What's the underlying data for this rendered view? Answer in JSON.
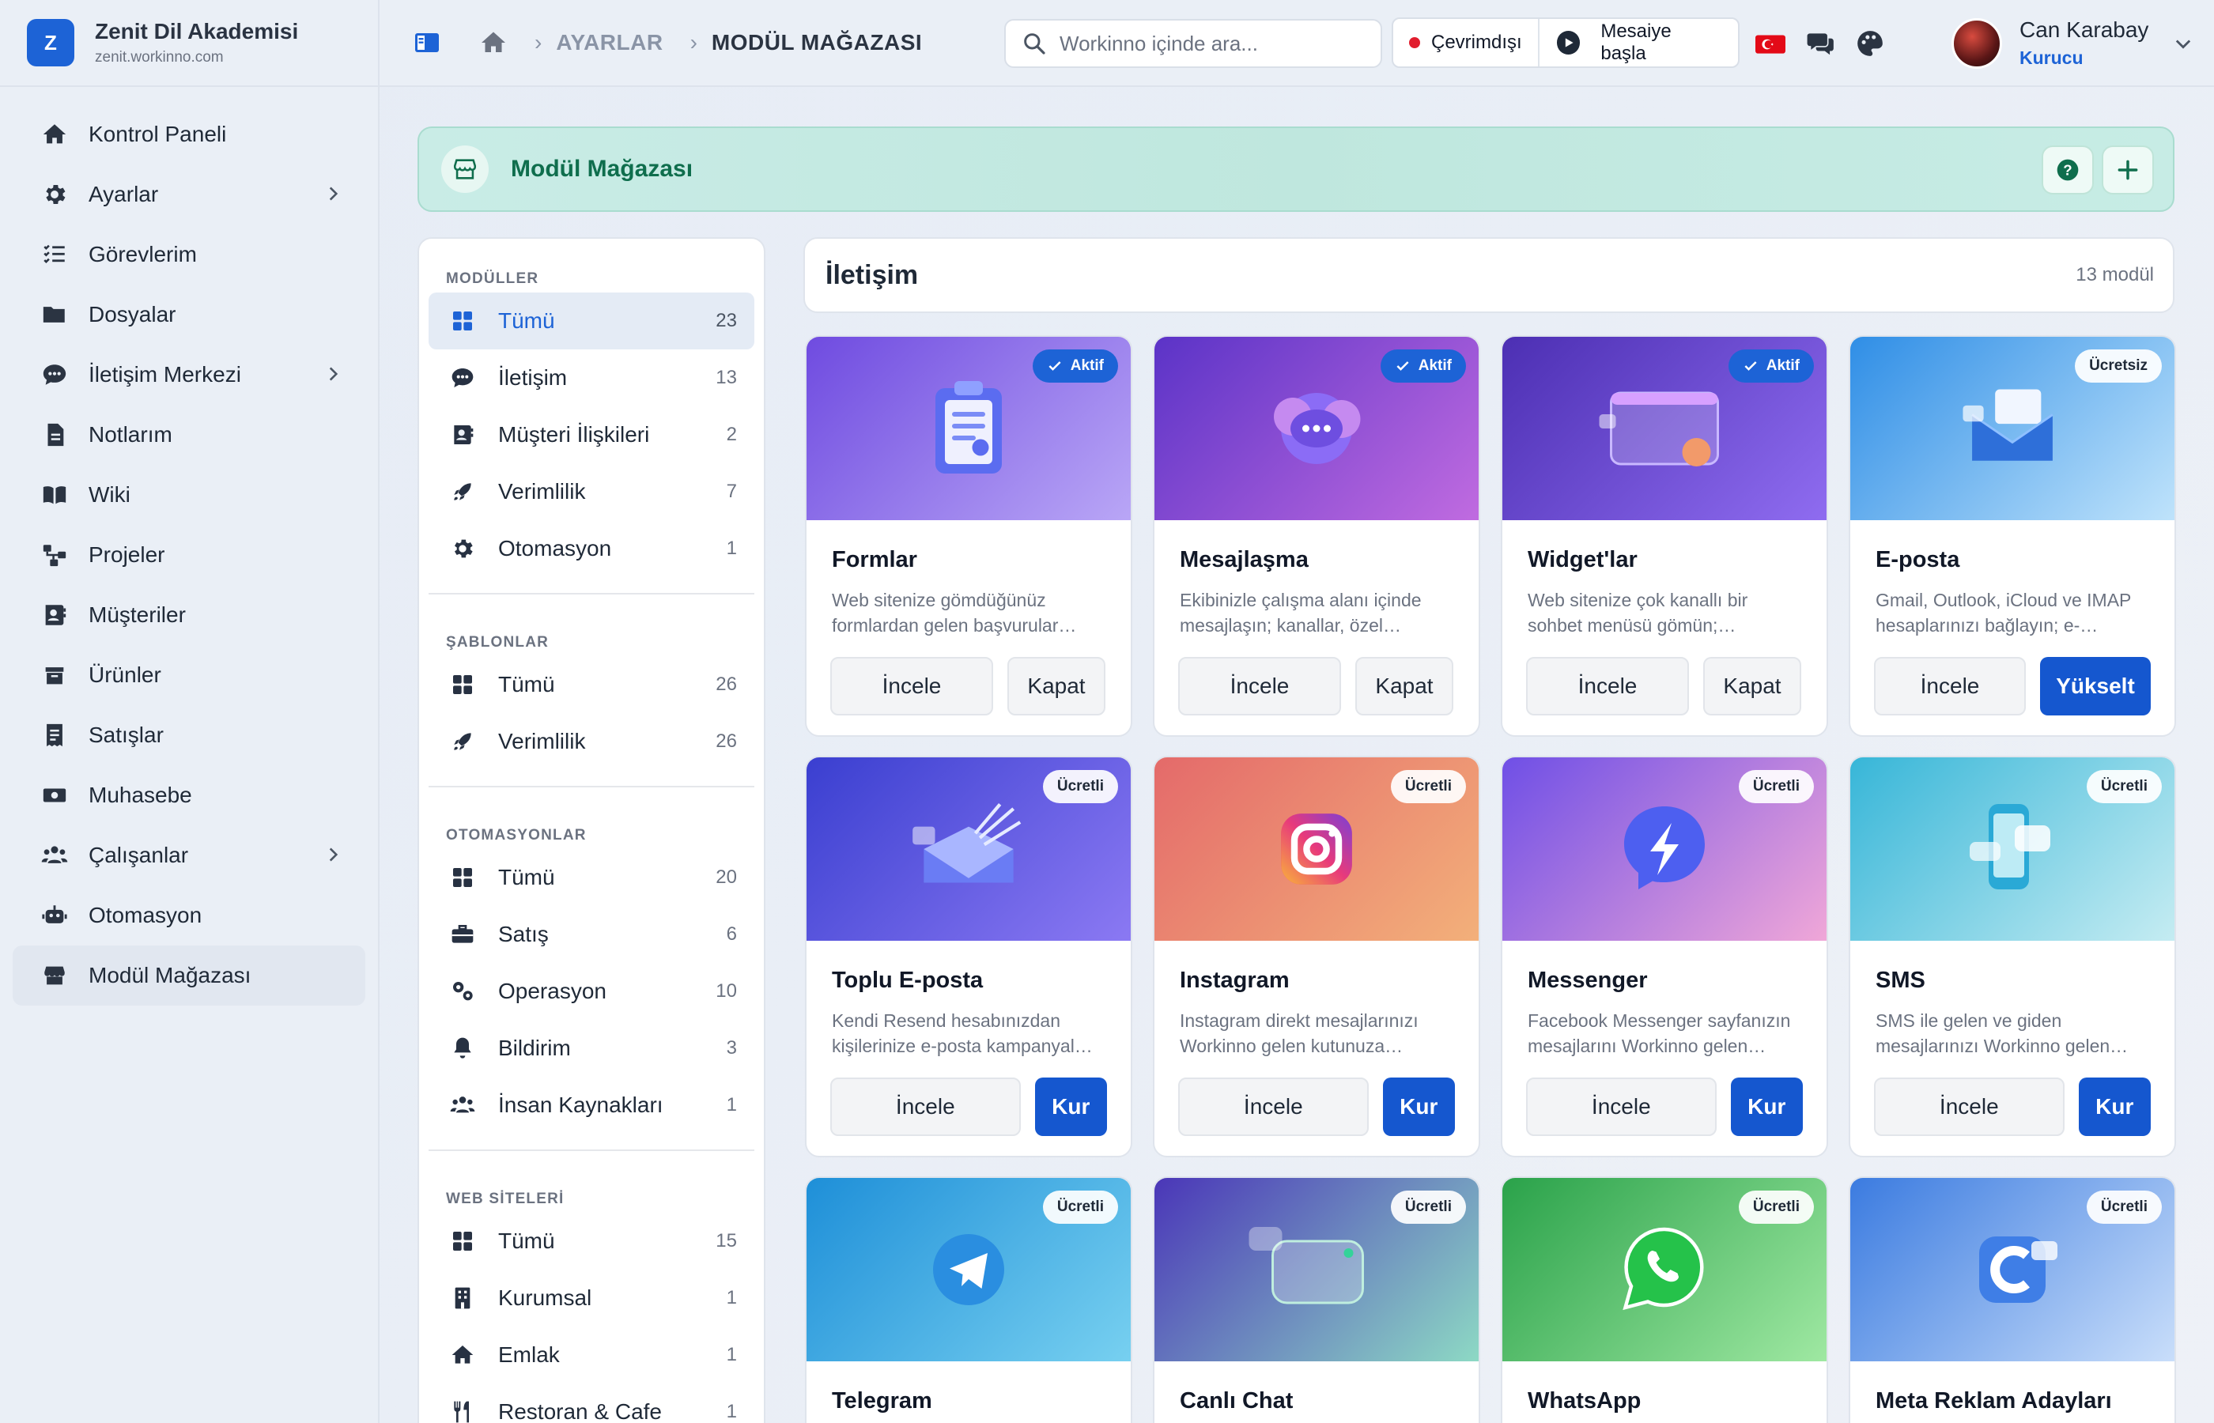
{
  "brand": {
    "logo_letter": "Z",
    "name": "Zenit Dil Akademisi",
    "url": "zenit.workinno.com"
  },
  "sidebar": {
    "items": [
      {
        "label": "Kontrol Paneli",
        "icon": "home-icon"
      },
      {
        "label": "Ayarlar",
        "icon": "gear-icon",
        "chevron": true
      },
      {
        "label": "Görevlerim",
        "icon": "tasks-icon"
      },
      {
        "label": "Dosyalar",
        "icon": "folder-icon"
      },
      {
        "label": "İletişim Merkezi",
        "icon": "chat-icon",
        "chevron": true
      },
      {
        "label": "Notlarım",
        "icon": "note-icon"
      },
      {
        "label": "Wiki",
        "icon": "book-icon"
      },
      {
        "label": "Projeler",
        "icon": "project-icon"
      },
      {
        "label": "Müşteriler",
        "icon": "contacts-icon"
      },
      {
        "label": "Ürünler",
        "icon": "box-icon"
      },
      {
        "label": "Satışlar",
        "icon": "receipt-icon"
      },
      {
        "label": "Muhasebe",
        "icon": "money-icon"
      },
      {
        "label": "Çalışanlar",
        "icon": "users-icon",
        "chevron": true
      },
      {
        "label": "Otomasyon",
        "icon": "robot-icon"
      },
      {
        "label": "Modül Mağazası",
        "icon": "store-icon",
        "active": true
      }
    ]
  },
  "topbar": {
    "breadcrumb": [
      "AYARLAR",
      "MODÜL MAĞAZASI"
    ],
    "search_placeholder": "Workinno içinde ara...",
    "status_offline": "Çevrimdışı",
    "status_start": "Mesaiye başla",
    "user_name": "Can Karabay",
    "user_role": "Kurucu"
  },
  "banner": {
    "title": "Modül Mağazası"
  },
  "filters": {
    "sections": [
      {
        "title": "MODÜLLER",
        "items": [
          {
            "label": "Tümü",
            "count": "23",
            "icon": "grid-icon",
            "active": true
          },
          {
            "label": "İletişim",
            "count": "13",
            "icon": "chat-icon"
          },
          {
            "label": "Müşteri İlişkileri",
            "count": "2",
            "icon": "contacts-icon"
          },
          {
            "label": "Verimlilik",
            "count": "7",
            "icon": "rocket-icon"
          },
          {
            "label": "Otomasyon",
            "count": "1",
            "icon": "gear-icon"
          }
        ]
      },
      {
        "title": "ŞABLONLAR",
        "items": [
          {
            "label": "Tümü",
            "count": "26",
            "icon": "grid-icon"
          },
          {
            "label": "Verimlilik",
            "count": "26",
            "icon": "rocket-icon"
          }
        ]
      },
      {
        "title": "OTOMASYONLAR",
        "items": [
          {
            "label": "Tümü",
            "count": "20",
            "icon": "grid-icon"
          },
          {
            "label": "Satış",
            "count": "6",
            "icon": "briefcase-icon"
          },
          {
            "label": "Operasyon",
            "count": "10",
            "icon": "gears-icon"
          },
          {
            "label": "Bildirim",
            "count": "3",
            "icon": "bell-icon"
          },
          {
            "label": "İnsan Kaynakları",
            "count": "1",
            "icon": "users-icon"
          }
        ]
      },
      {
        "title": "WEB SİTELERİ",
        "items": [
          {
            "label": "Tümü",
            "count": "15",
            "icon": "grid-icon"
          },
          {
            "label": "Kurumsal",
            "count": "1",
            "icon": "building-icon"
          },
          {
            "label": "Emlak",
            "count": "1",
            "icon": "home-icon"
          },
          {
            "label": "Restoran & Cafe",
            "count": "1",
            "icon": "utensils-icon"
          }
        ]
      }
    ]
  },
  "content": {
    "title": "İletişim",
    "count": "13 modül",
    "cards": [
      {
        "title": "Formlar",
        "desc": "Web sitenize gömdüğünüz formlardan gelen başvurular…",
        "badge": "Aktif",
        "badge_type": "active",
        "secondary": "İncele",
        "primary": "Kapat",
        "primary_style": "ghost",
        "art": "clipboard-icon",
        "bg": "#6f4be0",
        "bg2": "#b9a6f6"
      },
      {
        "title": "Mesajlaşma",
        "desc": "Ekibinizle çalışma alanı içinde mesajlaşın; kanallar, özel…",
        "badge": "Aktif",
        "badge_type": "active",
        "secondary": "İncele",
        "primary": "Kapat",
        "primary_style": "ghost",
        "art": "chat-bubbles-icon",
        "bg": "#5b33c7",
        "bg2": "#c06be0"
      },
      {
        "title": "Widget'lar",
        "desc": "Web sitenize çok kanallı bir sohbet menüsü gömün;…",
        "badge": "Aktif",
        "badge_type": "active",
        "secondary": "İncele",
        "primary": "Kapat",
        "primary_style": "ghost",
        "art": "widget-window-icon",
        "bg": "#4c2fb3",
        "bg2": "#8f6cf0"
      },
      {
        "title": "E-posta",
        "desc": "Gmail, Outlook, iCloud ve IMAP hesaplarınızı bağlayın; e-…",
        "badge": "Ücretsiz",
        "badge_type": "paid",
        "secondary": "İncele",
        "primary": "Yükselt",
        "primary_style": "primary",
        "art": "envelope-icon",
        "bg": "#2f8ee6",
        "bg2": "#bfe3fb"
      },
      {
        "title": "Toplu E-posta",
        "desc": "Kendi Resend hesabınızdan kişilerinize e-posta kampanyal…",
        "badge": "Ücretli",
        "badge_type": "paid",
        "secondary": "İncele",
        "primary": "Kur",
        "primary_style": "primary",
        "art": "mass-mail-icon",
        "bg": "#3a3fd0",
        "bg2": "#8b79f3"
      },
      {
        "title": "Instagram",
        "desc": "Instagram direkt mesajlarınızı Workinno gelen kutunuza…",
        "badge": "Ücretli",
        "badge_type": "paid",
        "secondary": "İncele",
        "primary": "Kur",
        "primary_style": "primary",
        "art": "instagram-icon",
        "bg": "#e46a6a",
        "bg2": "#f3b07a"
      },
      {
        "title": "Messenger",
        "desc": "Facebook Messenger sayfanızın mesajlarını Workinno gelen…",
        "badge": "Ücretli",
        "badge_type": "paid",
        "secondary": "İncele",
        "primary": "Kur",
        "primary_style": "primary",
        "art": "messenger-icon",
        "bg": "#6f4fe6",
        "bg2": "#f0a7d8"
      },
      {
        "title": "SMS",
        "desc": "SMS ile gelen ve giden mesajlarınızı Workinno gelen…",
        "badge": "Ücretli",
        "badge_type": "paid",
        "secondary": "İncele",
        "primary": "Kur",
        "primary_style": "primary",
        "art": "phone-sms-icon",
        "bg": "#37b6d8",
        "bg2": "#c5ecf2"
      },
      {
        "title": "Telegram",
        "desc": "",
        "badge": "Ücretli",
        "badge_type": "paid",
        "art": "telegram-icon",
        "bg": "#1e8fd8",
        "bg2": "#77d0f0"
      },
      {
        "title": "Canlı Chat",
        "desc": "",
        "badge": "Ücretli",
        "badge_type": "paid",
        "art": "live-chat-icon",
        "bg": "#4a36b8",
        "bg2": "#8dd9c4"
      },
      {
        "title": "WhatsApp",
        "desc": "",
        "badge": "Ücretli",
        "badge_type": "paid",
        "art": "whatsapp-icon",
        "bg": "#2aa24a",
        "bg2": "#9fe8a2"
      },
      {
        "title": "Meta Reklam Adayları",
        "desc": "",
        "badge": "Ücretli",
        "badge_type": "paid",
        "art": "meta-leads-icon",
        "bg": "#3b7be0",
        "bg2": "#c9defa"
      }
    ]
  },
  "colors": {
    "accent": "#1d63d6",
    "banner_text": "#0f6e4d",
    "offline": "#e11d2e"
  }
}
